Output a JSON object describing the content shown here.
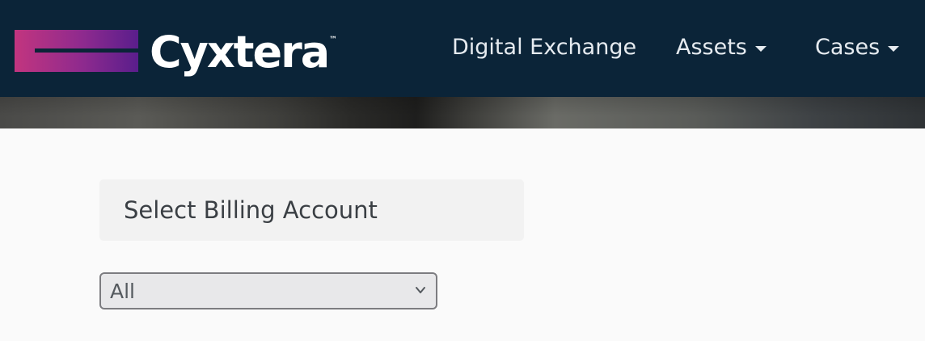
{
  "header": {
    "logo_text": "Cyxtera",
    "logo_tm": "™",
    "nav": {
      "digital_exchange": "Digital Exchange",
      "assets": "Assets",
      "cases": "Cases"
    }
  },
  "billing": {
    "title": "Select Billing Account",
    "selected": "All"
  },
  "colors": {
    "navbar": "#0b2438",
    "logo_gradient_start": "#c2357f",
    "logo_gradient_end": "#5a1e8c",
    "page_background": "#fafafa"
  },
  "icons": {
    "nav_caret": "caret-down-icon",
    "select_chevron": "chevron-down-icon"
  }
}
